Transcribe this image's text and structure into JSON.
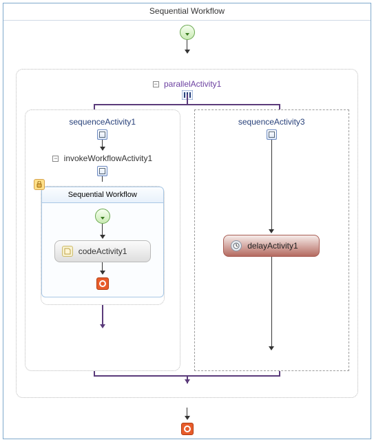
{
  "title": "Sequential Workflow",
  "parallel": {
    "label": "parallelActivity1",
    "branches": {
      "left": {
        "title": "sequenceActivity1",
        "invoke": {
          "label": "invokeWorkflowActivity1",
          "inner_title": "Sequential Workflow",
          "code_activity": "codeActivity1"
        }
      },
      "right": {
        "title": "sequenceActivity3",
        "delay_activity": "delayActivity1"
      }
    }
  }
}
